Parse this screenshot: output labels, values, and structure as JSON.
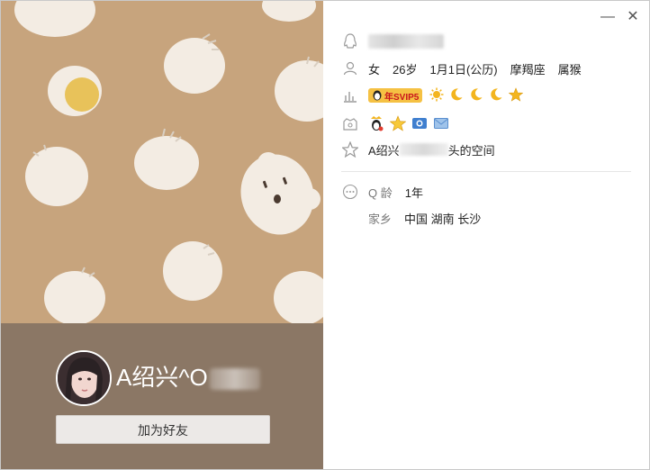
{
  "profile": {
    "nickname_visible": "A绍兴^O",
    "add_friend_label": "加为好友"
  },
  "info": {
    "gender": "女",
    "age": "26岁",
    "birthday": "1月1日(公历)",
    "zodiac": "摩羯座",
    "chinese_zodiac": "属猴",
    "vip_badge": "年SVIP5",
    "space_prefix": "A绍兴",
    "space_suffix": "头的空间",
    "qage_label": "Q 龄",
    "qage_value": "1年",
    "hometown_label": "家乡",
    "hometown_value": "中国 湖南 长沙"
  },
  "window": {
    "minimize_glyph": "—",
    "close_glyph": "✕"
  },
  "colors": {
    "cover_bg": "#c7a47d",
    "footer_bg": "#8b7765",
    "bun": "#f3ece3",
    "egg_yolk": "#e8c25a"
  },
  "icons": [
    "qq-icon",
    "user-icon",
    "level-icon",
    "badge-icon",
    "star-icon",
    "more-icon",
    "minimize-icon",
    "close-icon"
  ]
}
